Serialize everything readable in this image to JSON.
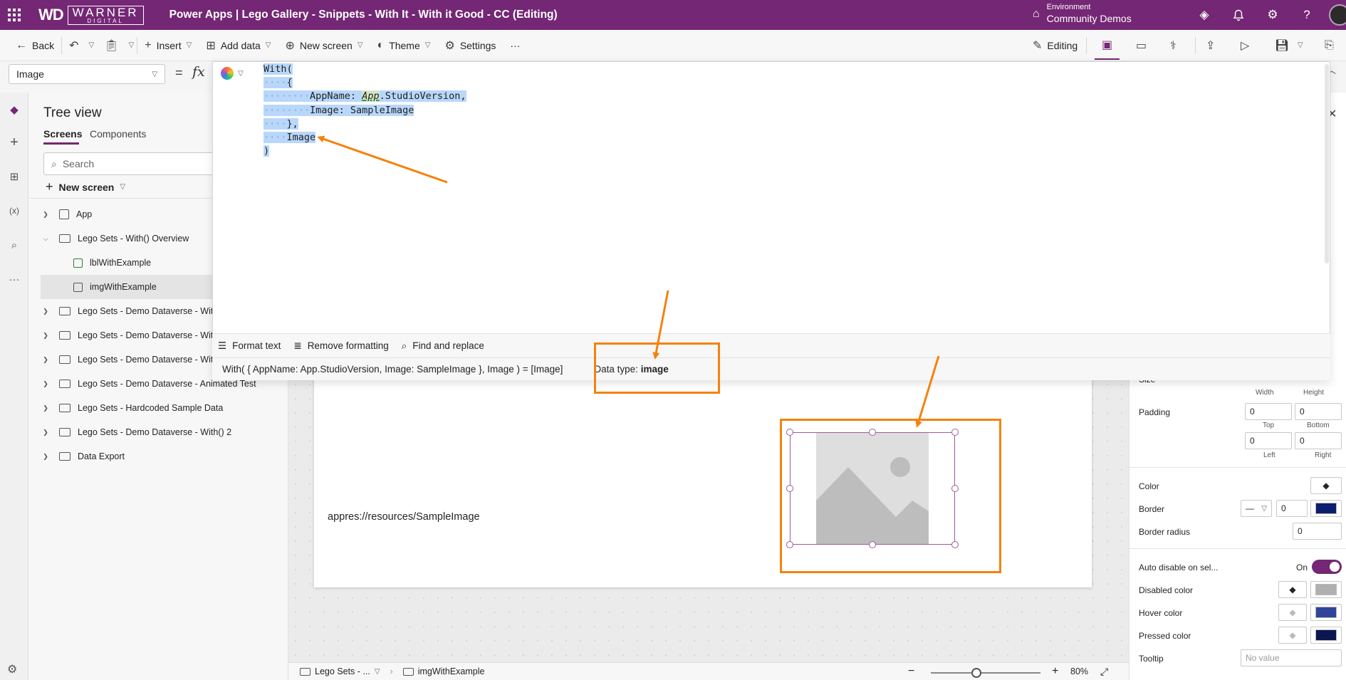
{
  "header": {
    "brand_mark": "WD",
    "brand_name": "WARNER",
    "brand_sub": "DIGITAL",
    "title": "Power Apps  |  Lego Gallery - Snippets - With It - With it Good - CC (Editing)",
    "environment_label": "Environment",
    "environment_value": "Community Demos"
  },
  "toolbar": {
    "back": "Back",
    "insert": "Insert",
    "add_data": "Add data",
    "new_screen": "New screen",
    "theme": "Theme",
    "settings": "Settings",
    "more": "···",
    "editing": "Editing"
  },
  "formula_bar": {
    "property": "Image",
    "equals": "=",
    "fx": "fx"
  },
  "formula_popup": {
    "code_lines": [
      {
        "indent": "",
        "text": "With("
      },
      {
        "indent": "····",
        "text": "{"
      },
      {
        "indent": "········",
        "pre": "AppName: ",
        "app": "App",
        "post": ".StudioVersion,"
      },
      {
        "indent": "········",
        "text": "Image: SampleImage"
      },
      {
        "indent": "····",
        "text": "},"
      },
      {
        "indent": "····",
        "text": "Image"
      },
      {
        "indent": "",
        "text": ")"
      }
    ],
    "tools": {
      "format_text": "Format text",
      "remove_formatting": "Remove formatting",
      "find_replace": "Find and replace"
    },
    "status_expression": "With( { AppName: App.StudioVersion, Image: SampleImage }, Image )  =  [Image]",
    "data_type_label": "Data type: ",
    "data_type_value": "image"
  },
  "tree_view": {
    "title": "Tree view",
    "tabs": {
      "screens": "Screens",
      "components": "Components"
    },
    "search_placeholder": "Search",
    "new_screen": "New screen",
    "items": [
      {
        "label": "App"
      },
      {
        "label": "Lego Sets - With() Overview"
      },
      {
        "label": "lblWithExample"
      },
      {
        "label": "imgWithExample"
      },
      {
        "label": "Lego Sets - Demo Dataverse - With"
      },
      {
        "label": "Lego Sets - Demo Dataverse - With"
      },
      {
        "label": "Lego Sets - Demo Dataverse - With"
      },
      {
        "label": "Lego Sets - Demo Dataverse - Animated Test"
      },
      {
        "label": "Lego Sets - Hardcoded Sample Data"
      },
      {
        "label": "Lego Sets - Demo Dataverse - With() 2"
      },
      {
        "label": "Data Export"
      }
    ]
  },
  "canvas": {
    "label_text": "appres://resources/SampleImage"
  },
  "properties": {
    "size_label": "Size",
    "width_label": "Width",
    "height_label": "Height",
    "padding_label": "Padding",
    "padding_top": "0",
    "padding_bottom": "0",
    "padding_left": "0",
    "padding_right": "0",
    "top_label": "Top",
    "bottom_label": "Bottom",
    "left_label": "Left",
    "right_label": "Right",
    "color_label": "Color",
    "border_label": "Border",
    "border_value": "0",
    "border_radius_label": "Border radius",
    "border_radius_value": "0",
    "auto_disable_label": "Auto disable on sel...",
    "auto_disable_value": "On",
    "disabled_color_label": "Disabled color",
    "hover_color_label": "Hover color",
    "pressed_color_label": "Pressed color",
    "tooltip_label": "Tooltip",
    "tooltip_placeholder": "No value",
    "colors": {
      "border": "#0b1f6e",
      "disabled": "#b0b0b0",
      "hover": "#30449a",
      "pressed": "#0b1650"
    }
  },
  "status_bar": {
    "screen_crumb": "Lego Sets - ...",
    "control_crumb": "imgWithExample",
    "zoom": "80%"
  },
  "theme": {
    "accent": "#742774",
    "annotation": "#f5820d"
  }
}
